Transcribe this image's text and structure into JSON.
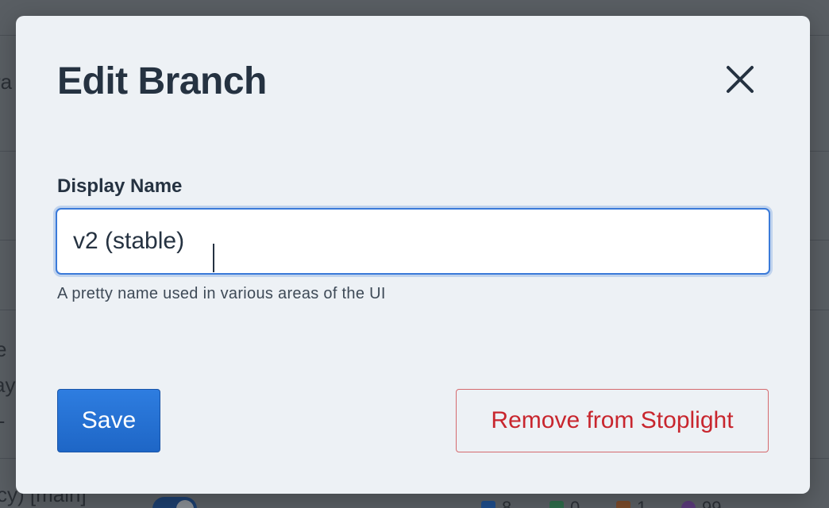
{
  "background": {
    "fragments": [
      "ra",
      "e",
      "ay",
      "l-",
      "cy) [main]"
    ],
    "stats": [
      "8",
      "0",
      "1",
      "99"
    ]
  },
  "modal": {
    "title": "Edit Branch",
    "close_icon": "close-icon",
    "field": {
      "label": "Display Name",
      "value": "v2 (stable)",
      "help": "A pretty name used in various areas of the UI"
    },
    "buttons": {
      "save": "Save",
      "remove": "Remove from Stoplight"
    }
  },
  "colors": {
    "accent": "#2e7de0",
    "danger": "#c8262e",
    "title": "#253241"
  }
}
